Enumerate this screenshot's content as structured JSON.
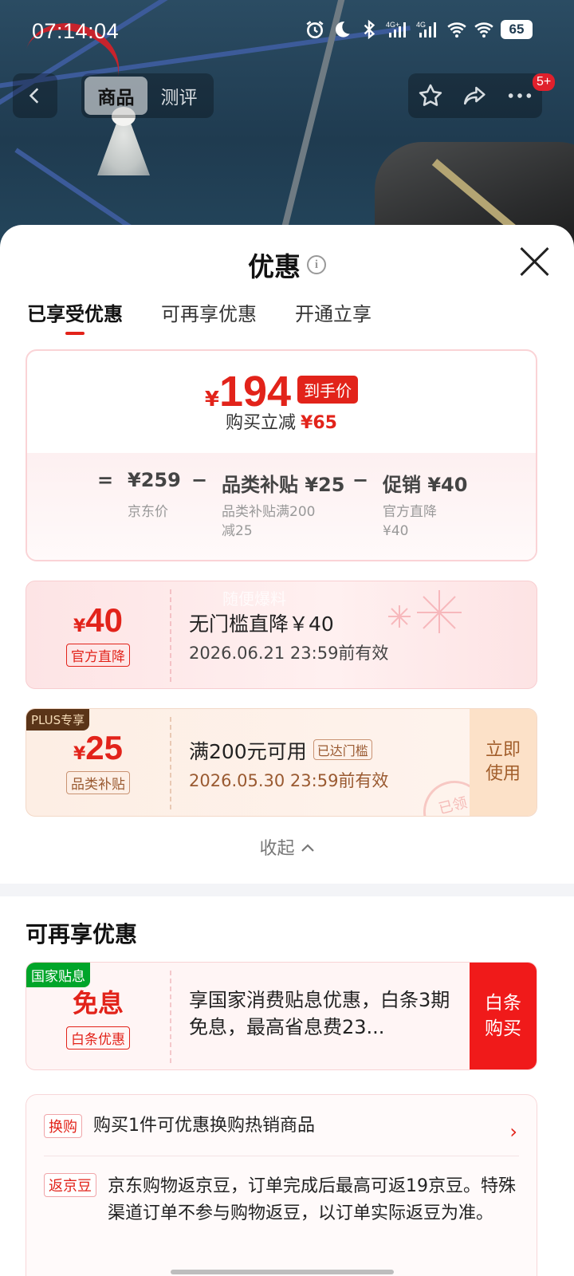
{
  "status": {
    "time": "07:14:04",
    "battery": "65",
    "network_labels": [
      "4G+",
      "4G"
    ]
  },
  "nav": {
    "tabs": [
      {
        "label": "商品",
        "active": true
      },
      {
        "label": "测评",
        "active": false
      }
    ],
    "more_badge": "5+"
  },
  "sheet": {
    "title": "优惠",
    "tabs": [
      {
        "label": "已享受优惠",
        "active": true
      },
      {
        "label": "可再享优惠",
        "active": false
      },
      {
        "label": "开通立享",
        "active": false
      }
    ]
  },
  "price_summary": {
    "currency": "¥",
    "final_price": "194",
    "final_label": "到手价",
    "reduce_label": "购买立减",
    "reduce_amount": "¥65",
    "formula": {
      "eq": "=",
      "base": "¥259",
      "base_note": "京东价",
      "minus1": "−",
      "sub1": "品类补贴 ¥25",
      "sub1_note_line1": "品类补贴满200",
      "sub1_note_line2": "减25",
      "minus2": "−",
      "sub2": "促销 ¥40",
      "sub2_note_line1": "官方直降",
      "sub2_note_line2": "¥40"
    }
  },
  "coupons": {
    "direct": {
      "currency": "¥",
      "amount": "40",
      "tag": "官方直降",
      "title": "无门槛直降￥40",
      "validity": "2026.06.21 23:59前有效",
      "watermark": "随便爆料"
    },
    "category": {
      "plus_label": "PLUS专享",
      "currency": "¥",
      "amount": "25",
      "tag": "品类补贴",
      "title": "满200元可用",
      "met_tag": "已达门槛",
      "validity": "2026.05.30 23:59前有效",
      "use_line1": "立即",
      "use_line2": "使用",
      "stamp": "已领"
    }
  },
  "collapse_label": "收起",
  "more_offers": {
    "title": "可再享优惠",
    "installment": {
      "gov_tag": "国家贴息",
      "headline": "免息",
      "tag": "白条优惠",
      "description": "享国家消费贴息优惠，白条3期免息，最高省息费23...",
      "btn_line1": "白条",
      "btn_line2": "购买"
    }
  },
  "extras": {
    "swap_tag": "换购",
    "swap_text": "购买1件可优惠换购热销商品",
    "bean_tag": "返京豆",
    "bean_text": "京东购物返京豆，订单完成后最高可返19京豆。特殊渠道订单不参与购物返豆，以订单实际返豆为准。"
  },
  "colors": {
    "accent_red": "#e2231a",
    "plus_brown": "#5a3418",
    "gov_green": "#00a52a"
  }
}
